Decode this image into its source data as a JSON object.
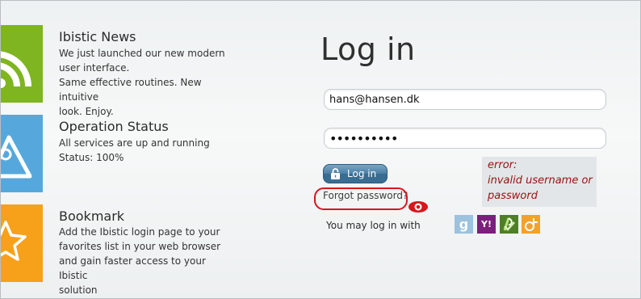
{
  "news": {
    "title": "Ibistic News",
    "lines": [
      "We just launched our new modern",
      "user interface.",
      "Same effective routines. New intuitive",
      "look. Enjoy."
    ],
    "tile_color": "#7fb520",
    "icon": "rss-icon"
  },
  "status": {
    "title": "Operation Status",
    "lines": [
      "All services are up and running",
      "Status: 100%"
    ],
    "tile_color": "#56a8dc",
    "icon": "warning-gear-icon"
  },
  "bookmark": {
    "title": "Bookmark",
    "lines": [
      "Add the Ibistic login page to your",
      "favorites list in your web browser",
      "and gain faster access to your Ibistic",
      "solution"
    ],
    "tile_color": "#f7a11a",
    "icon": "star-icon"
  },
  "login": {
    "title": "Log in",
    "email_value": "hans@hansen.dk",
    "password_value": "••••••••••",
    "button_label": "Log in",
    "forgot_label": "Forgot password?",
    "error_lines": [
      "error:",
      "invalid username or",
      "password"
    ],
    "error_color": "#9b1111",
    "social_prompt": "You may log in with"
  },
  "social": [
    {
      "name": "google",
      "glyph": "g",
      "icon": "google-icon",
      "color": "#9cc2dd"
    },
    {
      "name": "yahoo",
      "glyph": "Y!",
      "icon": "yahoo-icon",
      "color": "#7b1f7c"
    },
    {
      "name": "openid",
      "glyph": "",
      "icon": "openid-icon",
      "color": "#4e7f26"
    },
    {
      "name": "other",
      "glyph": "",
      "icon": "provider-icon",
      "color": "#f4a12b"
    }
  ]
}
